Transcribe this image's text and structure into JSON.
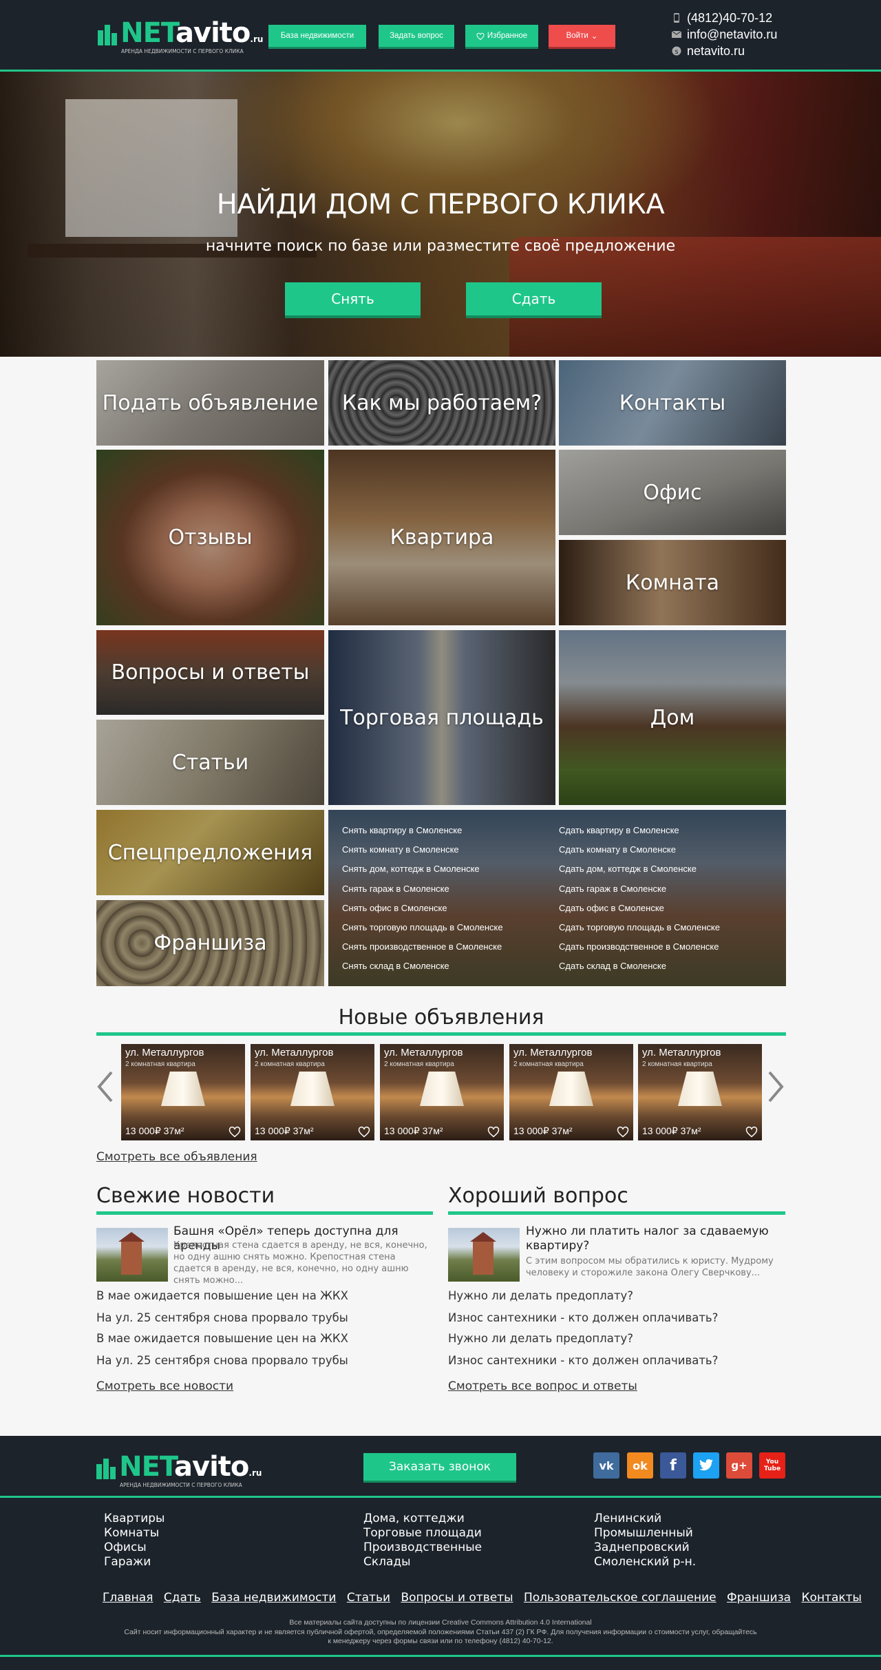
{
  "header": {
    "logo_net": "NET",
    "logo_avito": "avito",
    "logo_ru": ".ru",
    "logo_tagline": "АРЕНДА НЕДВИЖИМОСТИ С ПЕРВОГО КЛИКА",
    "buttons": [
      "База недвижимости",
      "Задать вопрос",
      "Избранное",
      "Войти"
    ],
    "phone": "(4812)40-70-12",
    "email": "info@netavito.ru",
    "skype": "netavito.ru"
  },
  "hero": {
    "title": "НАЙДИ ДОМ С ПЕРВОГО КЛИКА",
    "subtitle": "начните поиск по базе или разместите своё предложение",
    "rent_button": "Снять",
    "let_button": "Сдать"
  },
  "tiles": {
    "post_ad": "Подать объявление",
    "how_we_work": "Как мы работаем?",
    "contacts": "Контакты",
    "reviews": "Отзывы",
    "apartment": "Квартира",
    "office": "Офис",
    "room": "Комната",
    "faq": "Вопросы и ответы",
    "retail": "Торговая площадь",
    "house": "Дом",
    "articles": "Статьи",
    "special": "Спецпредложения",
    "franchise": "Франшиза"
  },
  "rent_links": [
    "Снять квартиру в Смоленске",
    "Снять комнату в Смоленске",
    "Снять дом, коттедж в Смоленске",
    "Снять гараж в Смоленске",
    "Снять офис в Смоленске",
    "Снять торговую площадь в Смоленске",
    "Снять производственное в Смоленске",
    "Снять склад в Смоленске"
  ],
  "let_links": [
    "Сдать квартиру в Смоленске",
    "Сдать комнату в Смоленске",
    "Сдать дом, коттедж в Смоленске",
    "Сдать гараж в Смоленске",
    "Сдать офис в Смоленске",
    "Сдать торговую площадь в Смоленске",
    "Сдать производственное в Смоленске",
    "Сдать склад в Смоленске"
  ],
  "new_listings": {
    "title": "Новые объявления",
    "cards": [
      {
        "street": "ул. Металлургов",
        "type": "2 комнатная квартира",
        "price": "13 000₽",
        "area": "37м²"
      },
      {
        "street": "ул. Металлургов",
        "type": "2 комнатная квартира",
        "price": "13 000₽",
        "area": "37м²"
      },
      {
        "street": "ул. Металлургов",
        "type": "2 комнатная квартира",
        "price": "13 000₽",
        "area": "37м²"
      },
      {
        "street": "ул. Металлургов",
        "type": "2 комнатная квартира",
        "price": "13 000₽",
        "area": "37м²"
      },
      {
        "street": "ул. Металлургов",
        "type": "2 комнатная квартира",
        "price": "13 000₽",
        "area": "37м²"
      }
    ],
    "see_all": "Смотреть все объявления"
  },
  "news": {
    "title": "Свежие новости",
    "featured_title": "Башня «Орёл» теперь доступна для аренды",
    "featured_text": "Крепостная стена сдается в аренду, не вся, конечно, но одну ашню снять можно. Крепостная стена сдается в аренду, не вся, конечно, но одну ашню снять можно...",
    "items": [
      "В мае ожидается повышение цен на ЖКХ",
      "На ул. 25 сентября снова прорвало трубы",
      "В мае ожидается повышение цен на ЖКХ",
      "На ул. 25 сентября снова прорвало трубы"
    ],
    "see_all": "Смотреть все новости"
  },
  "questions": {
    "title": "Хороший вопрос",
    "featured_title": "Нужно ли платить налог за сдаваемую квартиру?",
    "featured_text": "С этим вопросом мы обратились к юристу. Мудрому человеку и сторожиле закона Олегу Сверчкову...",
    "items": [
      "Нужно ли делать предоплату?",
      "Износ сантехники - кто должен оплачивать?",
      "Нужно ли делать предоплату?",
      "Износ сантехники - кто должен оплачивать?"
    ],
    "see_all": "Смотреть все вопрос и ответы"
  },
  "footer": {
    "call_button": "Заказать звонок",
    "social": [
      "vk",
      "ok",
      "f",
      "twitter",
      "g+",
      "You Tube"
    ],
    "col1": [
      "Квартиры",
      "Комнаты",
      "Офисы",
      "Гаражи"
    ],
    "col2": [
      "Дома, коттеджи",
      "Торговые площади",
      "Производственные",
      "Склады"
    ],
    "col3": [
      "Ленинский",
      "Промышленный",
      "Заднепровский",
      "Смоленский р-н."
    ],
    "nav": [
      "Главная",
      "Сдать",
      "База недвижимости",
      "Статьи",
      "Вопросы и ответы",
      "Пользовательское соглашение",
      "Франшиза",
      "Контакты"
    ],
    "license": "Все материалы сайта доступны по лицензии Creative Commons Attribution 4.0 International",
    "disclaimer": "Сайт носит информационный характер и не является публичной офертой, определяемой положениями Статьи 437 (2) ГК РФ. Для получения информации о стоимости услуг, обращайтесь",
    "disclaimer2": "к менеджеру через формы связи или по телефону (4812) 40-70-12."
  },
  "colors": {
    "accent": "#1fc68a",
    "dark": "#1c232b",
    "login": "#ef4c4c"
  }
}
